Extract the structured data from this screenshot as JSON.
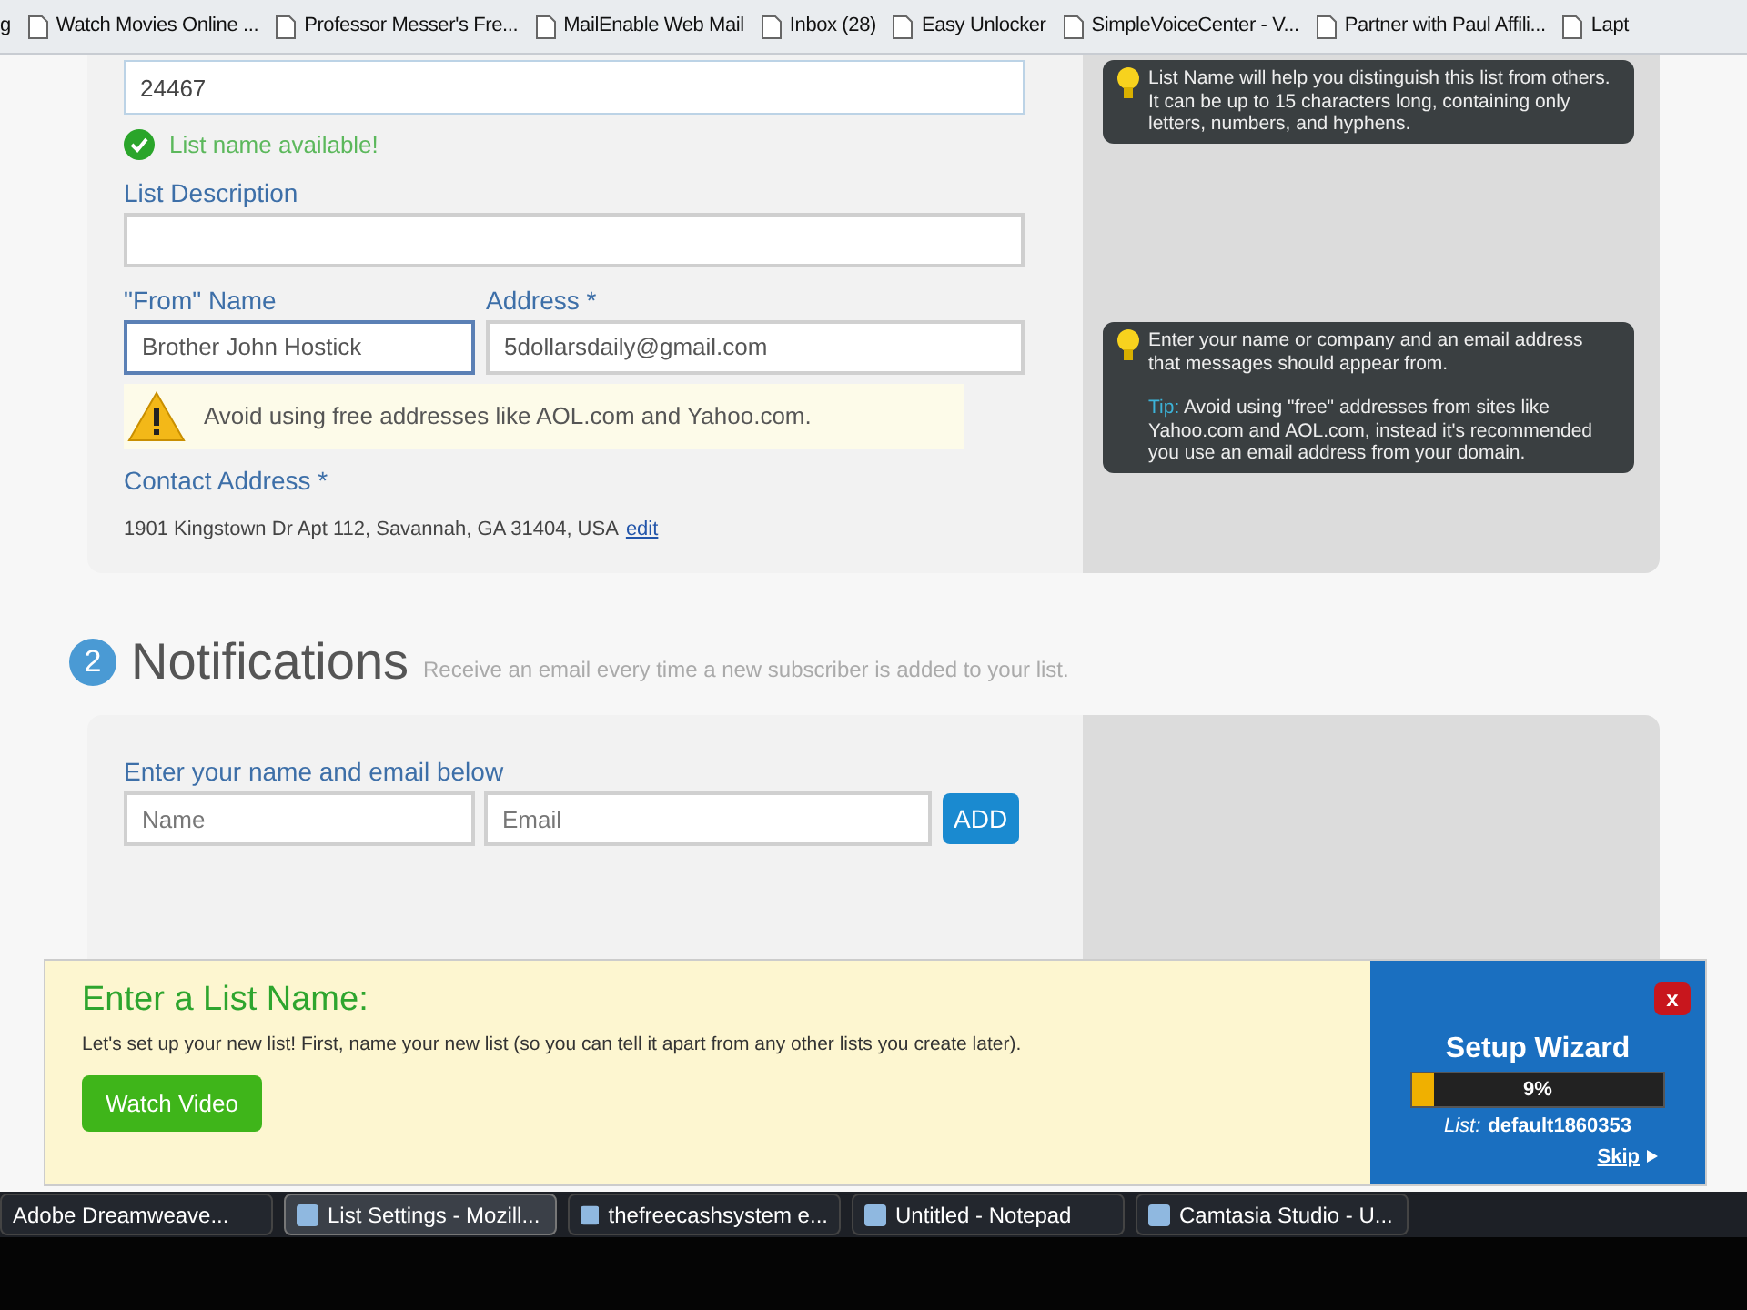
{
  "bookmarks": [
    {
      "label": "g"
    },
    {
      "label": "Watch Movies Online ..."
    },
    {
      "label": "Professor Messer's Fre..."
    },
    {
      "label": "MailEnable Web Mail"
    },
    {
      "label": "Inbox (28)"
    },
    {
      "label": "Easy Unlocker"
    },
    {
      "label": "SimpleVoiceCenter - V..."
    },
    {
      "label": "Partner with Paul Affili..."
    },
    {
      "label": "Lapt"
    }
  ],
  "list_settings": {
    "list_name": {
      "value": "24467",
      "status": "List name available!"
    },
    "description": {
      "label": "List Description"
    },
    "from_name": {
      "label": "\"From\" Name",
      "value": "Brother John Hostick"
    },
    "address": {
      "label": "Address *",
      "value": "5dollarsdaily@gmail.com"
    },
    "warning": "Avoid using free addresses like AOL.com and Yahoo.com.",
    "contact": {
      "label": "Contact Address *",
      "value": "1901 Kingstown Dr Apt 112, Savannah, GA 31404, USA",
      "link": "edit"
    },
    "tips": [
      {
        "text": "List Name will help you distinguish this list from others. It can be up to 15 characters long, containing only letters, numbers, and hyphens."
      },
      {
        "text": "Enter your name or company and an email address that messages should appear from.",
        "tip_label": "Tip:",
        "tip": "Avoid using \"free\" addresses from sites like Yahoo.com and AOL.com, instead it's recommended you use an email address from your domain."
      }
    ]
  },
  "notifications": {
    "step": "2",
    "title": "Notifications",
    "subtitle": "Receive an email every time a new subscriber is added to your list.",
    "prompt": "Enter your name and email below",
    "name_placeholder": "Name",
    "email_placeholder": "Email",
    "button": "ADD"
  },
  "wizard_bar": {
    "heading": "Enter a List Name:",
    "text": "Let's set up your new list! First, name your new list (so you can tell it apart from any other lists you create later).",
    "button": "Watch Video",
    "close": "x",
    "title": "Setup Wizard",
    "level": 0.09,
    "reading": "9%",
    "list_label": "List:",
    "list_value": "default1860353",
    "skip": "Skip"
  },
  "taskbar": [
    {
      "label": "Adobe Dreamweave...",
      "selected": false
    },
    {
      "label": "List Settings - Mozill...",
      "selected": true
    },
    {
      "label": "thefreecashsystem e...",
      "selected": false
    },
    {
      "label": "Untitled - Notepad",
      "selected": false
    },
    {
      "label": "Camtasia Studio - U...",
      "selected": false
    }
  ]
}
